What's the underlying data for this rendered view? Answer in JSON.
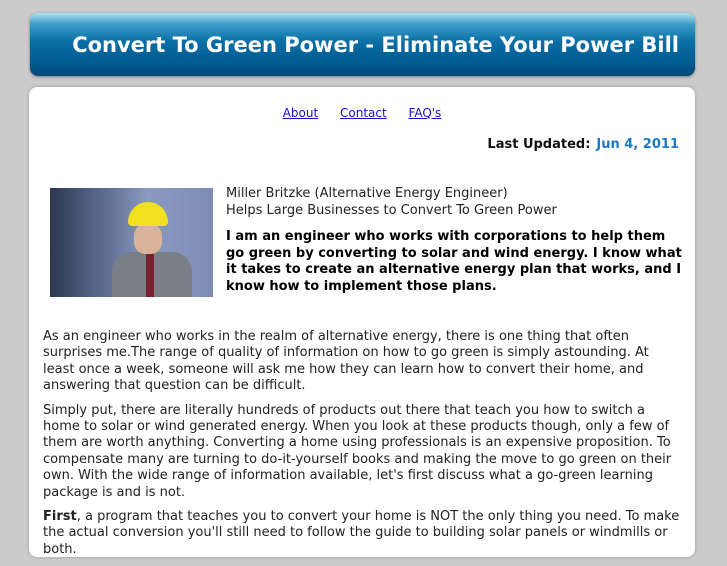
{
  "header": {
    "title": "Convert To Green Power - Eliminate Your Power Bill"
  },
  "nav": [
    {
      "label": "About"
    },
    {
      "label": "Contact"
    },
    {
      "label": "FAQ's"
    }
  ],
  "updated": {
    "label": "Last Updated:",
    "date": "Jun 4, 2011"
  },
  "bio": {
    "name": "Miller Britzke (Alternative Energy Engineer)",
    "tagline": "Helps Large Businesses to Convert To Green Power",
    "intro": "I am an engineer who works with corporations to help them go green by converting to solar and wind energy. I know what it takes to create an alternative energy plan that works, and I know how to implement those plans."
  },
  "paragraphs": [
    "As an engineer who works in the realm of alternative energy, there is one thing that often surprises me.The range of quality of information on how to go green is simply astounding. At least once a week, someone will ask me how they can learn how to convert their home, and answering that question can be difficult.",
    "Simply put, there are literally hundreds of products out there that teach you how to switch a home to solar or wind generated energy. When you look at these products though, only a few of them are worth anything. Converting a home using professionals is an expensive proposition. To compensate many are turning to do-it-yourself books and making the move to go green on their own. With the wide range of information available, let's first discuss what a go-green learning package is and is not."
  ],
  "third": {
    "lead": "First",
    "text": ", a program that teaches you to convert your home is NOT the only thing you need. To make the actual conversion you'll still need to follow the guide to building solar panels or windmills or both."
  }
}
